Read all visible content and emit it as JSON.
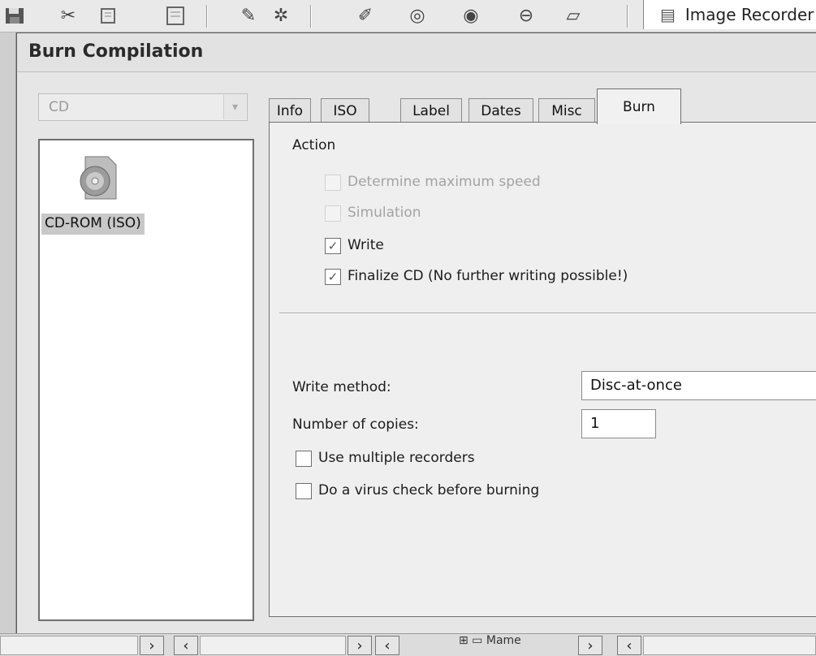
{
  "background_app": {
    "recorder_tab_label": "Image Recorder",
    "toolbar_icons": [
      "save-icon",
      "cut-icon",
      "copy-icon",
      "paste-icon",
      "edit-icon",
      "wand-icon",
      "brush-icon",
      "disc-icon",
      "disc-write-icon",
      "disc-erase-icon",
      "folder-icon"
    ],
    "tree_node_label": "Mame"
  },
  "dialog": {
    "title": "Burn Compilation",
    "media_combo": {
      "value": "CD"
    },
    "compilation_list": [
      {
        "label": "CD-ROM (ISO)",
        "icon": "cd-rom-iso-icon",
        "selected": true
      }
    ],
    "tabs": [
      {
        "label": "Info",
        "active": false
      },
      {
        "label": "ISO",
        "active": false
      },
      {
        "label": "Label",
        "active": false
      },
      {
        "label": "Dates",
        "active": false
      },
      {
        "label": "Misc",
        "active": false
      },
      {
        "label": "Burn",
        "active": true
      }
    ],
    "burn": {
      "action_heading": "Action",
      "actions": [
        {
          "label": "Determine maximum speed",
          "checked": false,
          "enabled": false
        },
        {
          "label": "Simulation",
          "checked": false,
          "enabled": false
        },
        {
          "label": "Write",
          "checked": true,
          "enabled": true
        },
        {
          "label": "Finalize CD (No further writing possible!)",
          "checked": true,
          "enabled": true
        }
      ],
      "write_method_label": "Write method:",
      "write_method_value": "Disc-at-once",
      "copies_label": "Number of copies:",
      "copies_value": "1",
      "options": [
        {
          "label": "Use multiple recorders",
          "checked": false
        },
        {
          "label": "Do a virus check before burning",
          "checked": false
        }
      ]
    }
  }
}
